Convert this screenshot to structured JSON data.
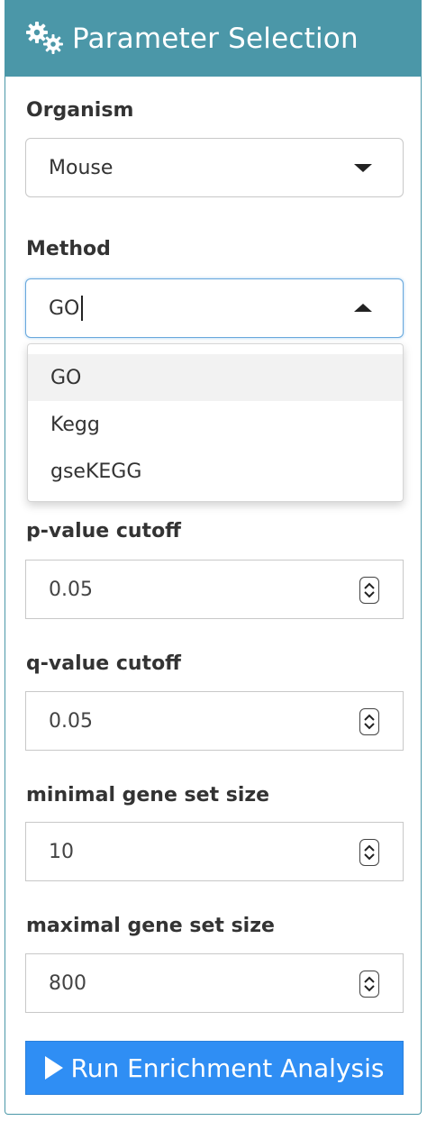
{
  "panel": {
    "title": "Parameter Selection",
    "header_icon": "gears-icon",
    "accent": "#4b97a8"
  },
  "organism": {
    "label": "Organism",
    "value": "Mouse"
  },
  "method": {
    "label": "Method",
    "value": "GO",
    "options": [
      "GO",
      "Kegg",
      "gseKEGG"
    ]
  },
  "pvalue": {
    "label": "p-value cutoff",
    "value": "0.05"
  },
  "qvalue": {
    "label": "q-value cutoff",
    "value": "0.05"
  },
  "min_gs": {
    "label": "minimal gene set size",
    "value": "10"
  },
  "max_gs": {
    "label": "maximal gene set size",
    "value": "800"
  },
  "run_button": {
    "label": "Run Enrichment Analysis",
    "icon": "play-icon",
    "color": "#2f8ef4"
  }
}
